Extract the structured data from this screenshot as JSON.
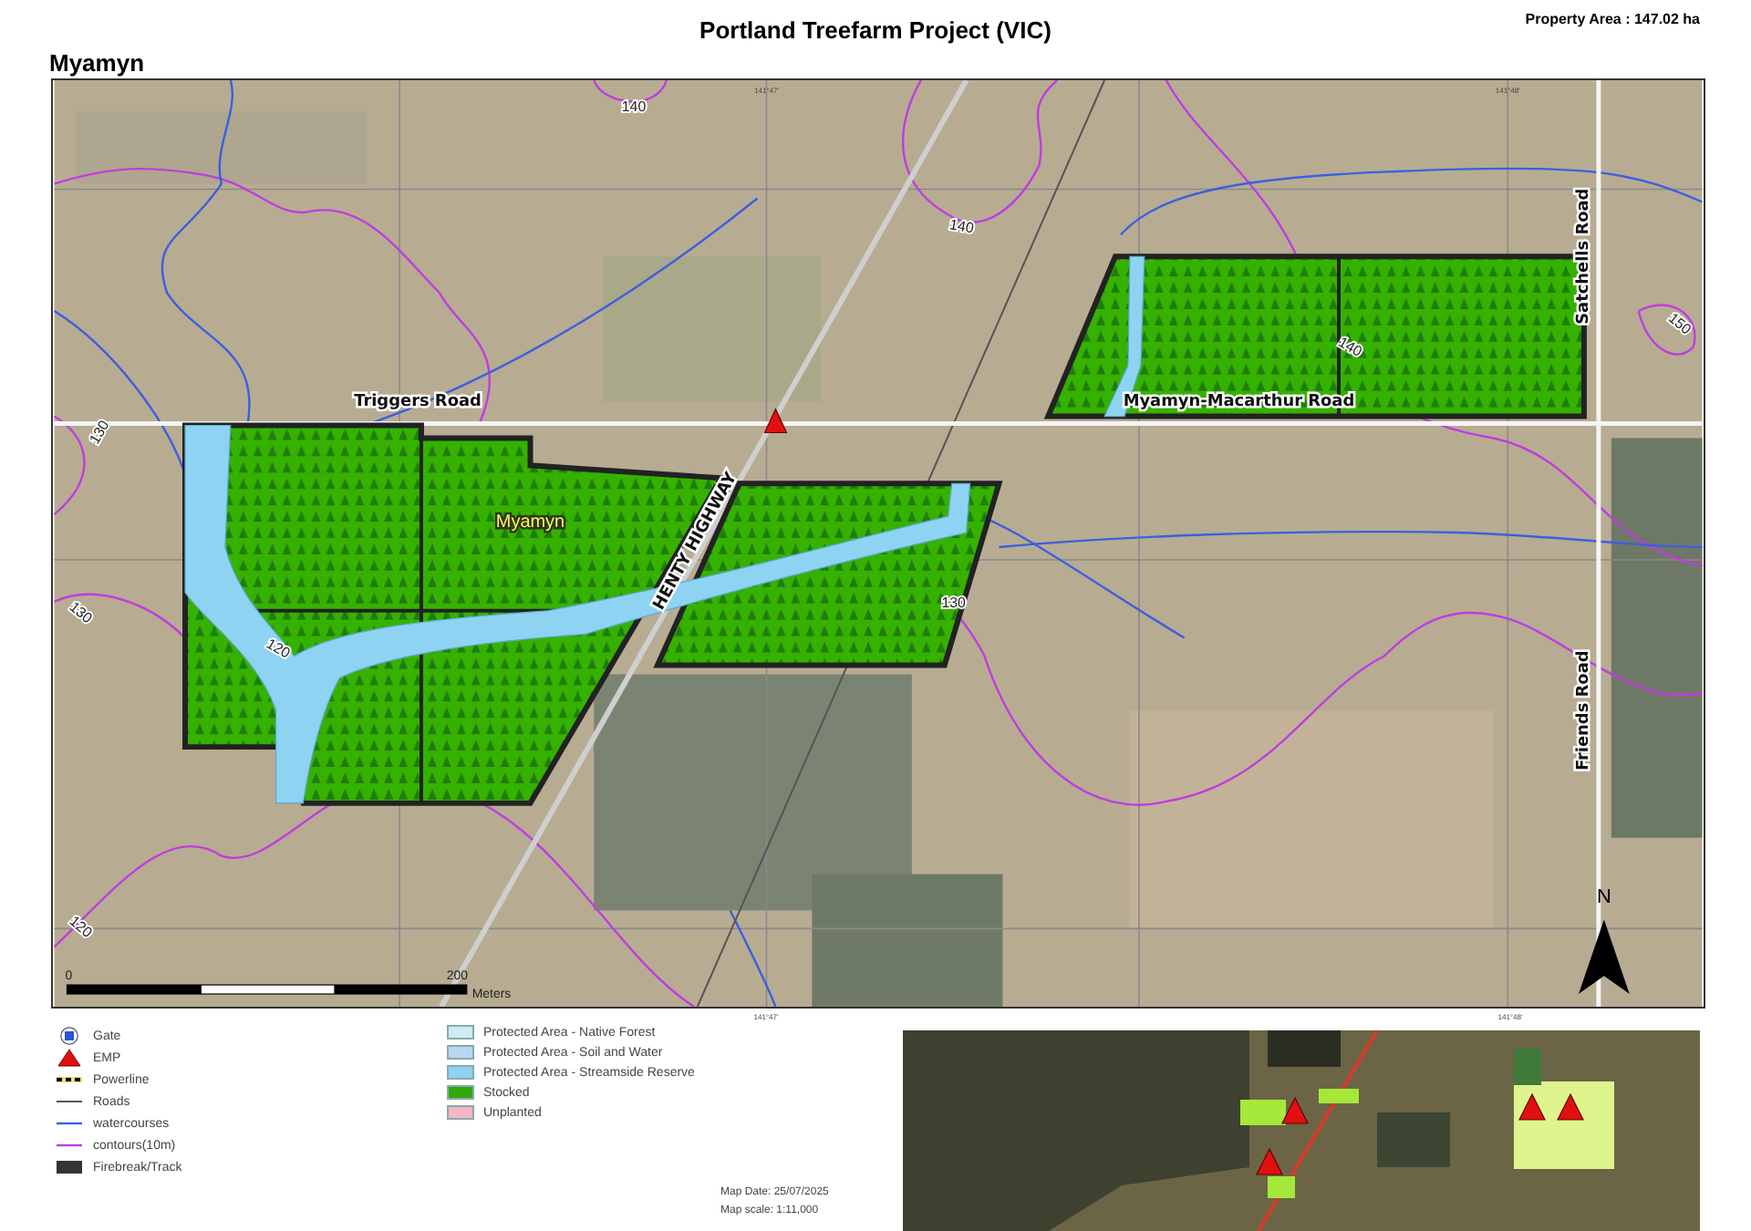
{
  "header": {
    "title": "Portland Treefarm Project (VIC)",
    "property_area": "Property Area : 147.02 ha",
    "location": "Myamyn"
  },
  "map": {
    "graticule_labels": [
      "141°47'",
      "141°48'",
      "141°47'",
      "141°48'"
    ],
    "road_labels": [
      "Triggers Road",
      "Myamyn-Macarthur Road",
      "HENTY HIGHWAY",
      "Satchells Road",
      "Friends Road"
    ],
    "place_label": "Myamyn",
    "contour_labels": [
      "140",
      "140",
      "140",
      "150",
      "130",
      "120",
      "130",
      "130",
      "120"
    ],
    "scale_bar": {
      "start": "0",
      "end": "200",
      "unit": "Meters"
    },
    "north_label": "N"
  },
  "legend": {
    "symbols": [
      {
        "kind": "gate",
        "label": "Gate"
      },
      {
        "kind": "emp",
        "label": "EMP"
      },
      {
        "kind": "powerline",
        "label": "Powerline"
      },
      {
        "kind": "road",
        "label": "Roads"
      },
      {
        "kind": "watercourse",
        "label": "watercourses"
      },
      {
        "kind": "contour",
        "label": "contours(10m)"
      },
      {
        "kind": "firebreak",
        "label": "Firebreak/Track"
      }
    ],
    "areas": [
      {
        "label": "Protected Area - Native Forest",
        "color": "#cfeaf7"
      },
      {
        "label": "Protected Area - Soil and Water",
        "color": "#b9d7f2"
      },
      {
        "label": "Protected Area - Streamside Reserve",
        "color": "#8fd3f2"
      },
      {
        "label": "Stocked",
        "color": "#2fa80a"
      },
      {
        "label": "Unplanted",
        "color": "#f4b6c4"
      }
    ]
  },
  "map_info": {
    "date": "Map Date: 25/07/2025",
    "scale": "Map scale: 1:11,000"
  }
}
